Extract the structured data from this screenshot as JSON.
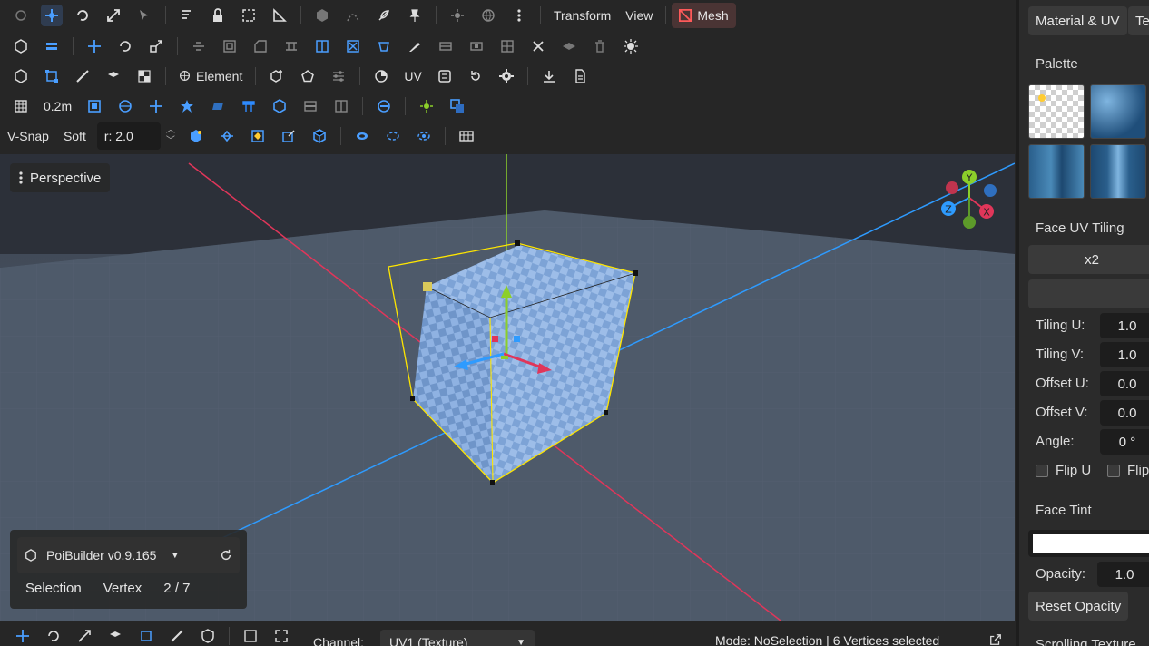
{
  "toolbar": {
    "transform_label": "Transform",
    "view_label": "View",
    "mesh_label": "Mesh",
    "element_label": "Element",
    "uv_label": "UV",
    "grid_size": "0.2m",
    "vsnap_label": "V-Snap",
    "soft_label": "Soft",
    "radius_value": "r: 2.0"
  },
  "viewport": {
    "camera_label": "Perspective",
    "gizmo": {
      "x": "X",
      "y": "Y",
      "z": "Z"
    }
  },
  "info_panel": {
    "app_version": "PoiBuilder v0.9.165",
    "selection_label": "Selection",
    "mode_label": "Vertex",
    "count": "2 / 7"
  },
  "bottom_bar": {
    "channel_label": "Channel:",
    "channel_value": "UV1 (Texture)",
    "status": "Mode: NoSelection | 6 Vertices selected"
  },
  "right_panel": {
    "tabs": [
      "Material & UV",
      "Te"
    ],
    "palette_label": "Palette",
    "face_uv_tiling_label": "Face UV Tiling",
    "tiling_preset": "x2",
    "fields": [
      {
        "label": "Tiling U:",
        "value": "1.0"
      },
      {
        "label": "Tiling V:",
        "value": "1.0"
      },
      {
        "label": "Offset U:",
        "value": "0.0"
      },
      {
        "label": "Offset V:",
        "value": "0.0"
      },
      {
        "label": "Angle:",
        "value": "0 °"
      }
    ],
    "flip_u_label": "Flip U",
    "flip_v_label": "Flip",
    "face_tint_label": "Face Tint",
    "tint_color": "#ffffff",
    "opacity_label": "Opacity:",
    "opacity_value": "1.0",
    "reset_opacity_label": "Reset Opacity",
    "next_section_label": "Scrolling Texture"
  },
  "colors": {
    "accent": "#4a9eff",
    "x_axis": "#e0365a",
    "y_axis": "#8ccf2a",
    "z_axis": "#2e9bff",
    "selection": "#ffe600",
    "mesh_red": "#ff5a5a"
  }
}
